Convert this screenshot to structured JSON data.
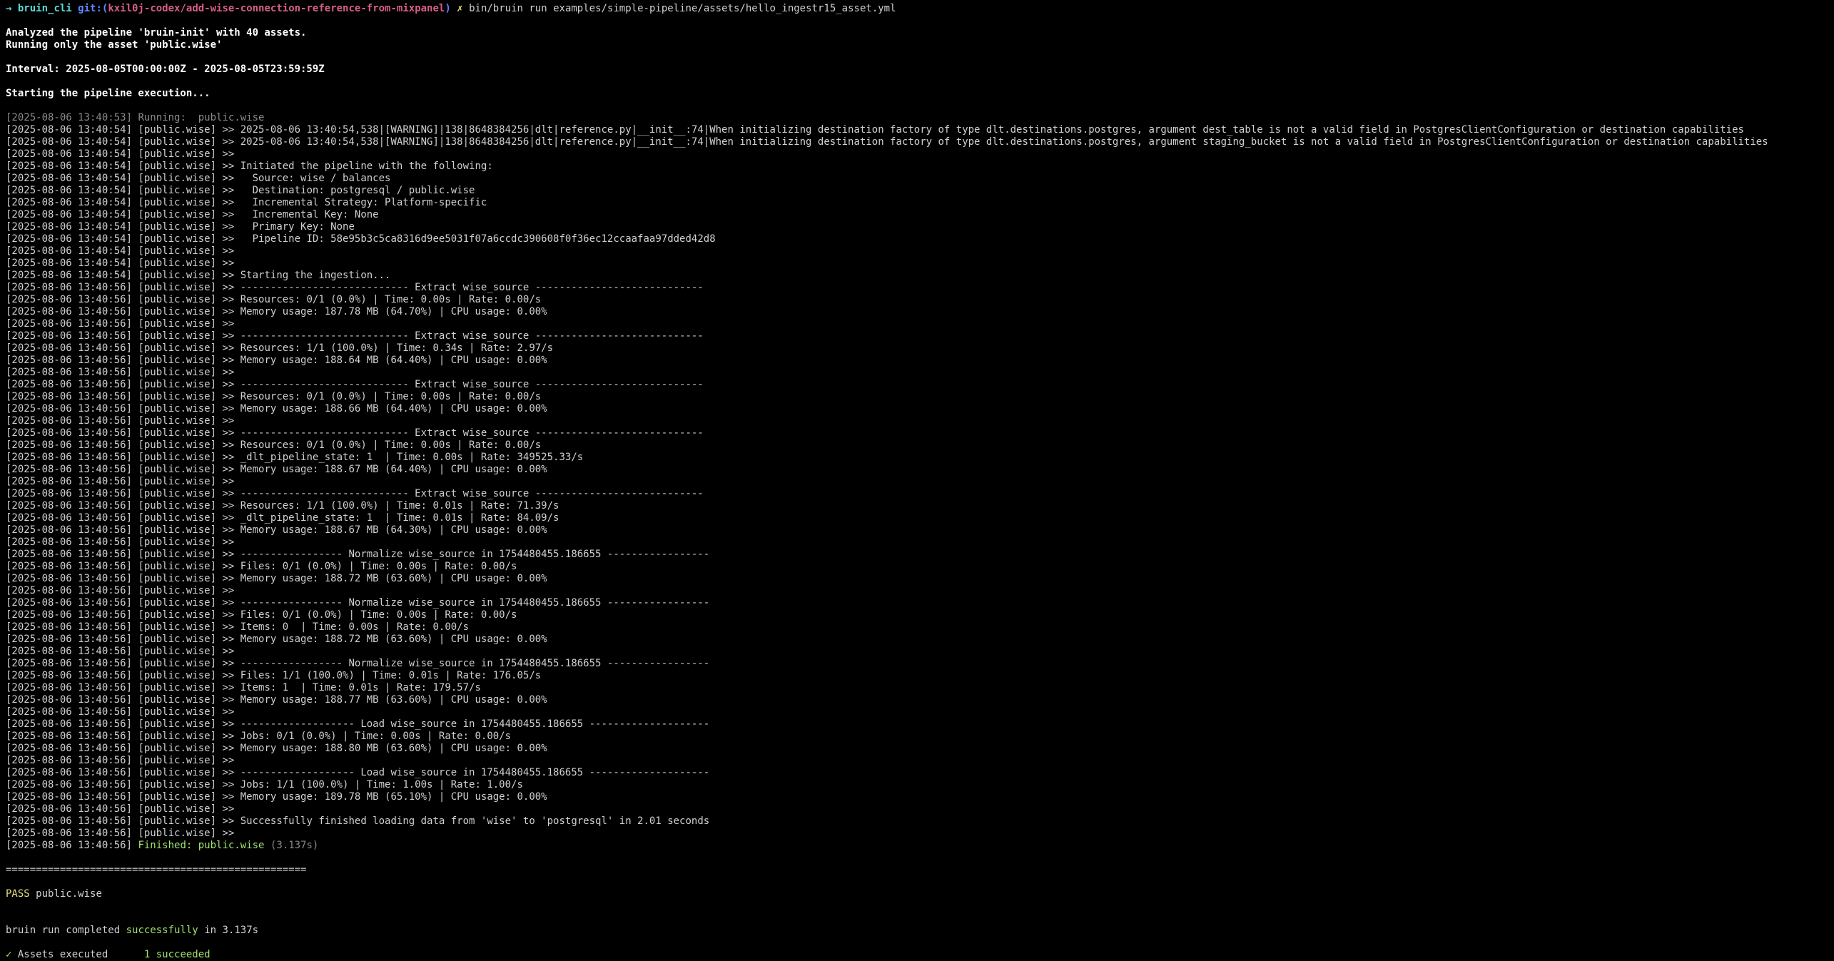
{
  "prompt": {
    "arrow": "→",
    "dir": "bruin_cli",
    "git_label": "git:(",
    "branch": "kxil0j-codex/add-wise-connection-reference-from-mixpanel",
    "git_close": ")",
    "dirty": "✗",
    "command": "bin/bruin run examples/simple-pipeline/assets/hello_ingestr15_asset.yml"
  },
  "header": {
    "analyzed": "Analyzed the pipeline 'bruin-init' with 40 assets.",
    "running_only": "Running only the asset 'public.wise'",
    "interval": "Interval: 2025-08-05T00:00:00Z - 2025-08-05T23:59:59Z",
    "starting": "Starting the pipeline execution..."
  },
  "running": {
    "ts": "[2025-08-06 13:40:53]",
    "label": "Running:  public.wise"
  },
  "log_prefix_asset": "[public.wise] >>",
  "log_lines": [
    {
      "ts": "[2025-08-06 13:40:54]",
      "msg": "2025-08-06 13:40:54,538|[WARNING]|138|8648384256|dlt|reference.py|__init__:74|When initializing destination factory of type dlt.destinations.postgres, argument dest_table is not a valid field in PostgresClientConfiguration or destination capabilities"
    },
    {
      "ts": "[2025-08-06 13:40:54]",
      "msg": "2025-08-06 13:40:54,538|[WARNING]|138|8648384256|dlt|reference.py|__init__:74|When initializing destination factory of type dlt.destinations.postgres, argument staging_bucket is not a valid field in PostgresClientConfiguration or destination capabilities"
    },
    {
      "ts": "[2025-08-06 13:40:54]",
      "msg": ""
    },
    {
      "ts": "[2025-08-06 13:40:54]",
      "msg": "Initiated the pipeline with the following:"
    },
    {
      "ts": "[2025-08-06 13:40:54]",
      "msg": "  Source: wise / balances"
    },
    {
      "ts": "[2025-08-06 13:40:54]",
      "msg": "  Destination: postgresql / public.wise"
    },
    {
      "ts": "[2025-08-06 13:40:54]",
      "msg": "  Incremental Strategy: Platform-specific"
    },
    {
      "ts": "[2025-08-06 13:40:54]",
      "msg": "  Incremental Key: None"
    },
    {
      "ts": "[2025-08-06 13:40:54]",
      "msg": "  Primary Key: None"
    },
    {
      "ts": "[2025-08-06 13:40:54]",
      "msg": "  Pipeline ID: 58e95b3c5ca8316d9ee5031f07a6ccdc390608f0f36ec12ccaafaa97dded42d8"
    },
    {
      "ts": "[2025-08-06 13:40:54]",
      "msg": ""
    },
    {
      "ts": "[2025-08-06 13:40:54]",
      "msg": ""
    },
    {
      "ts": "[2025-08-06 13:40:54]",
      "msg": "Starting the ingestion..."
    },
    {
      "ts": "[2025-08-06 13:40:56]",
      "msg": "---------------------------- Extract wise_source ----------------------------"
    },
    {
      "ts": "[2025-08-06 13:40:56]",
      "msg": "Resources: 0/1 (0.0%) | Time: 0.00s | Rate: 0.00/s"
    },
    {
      "ts": "[2025-08-06 13:40:56]",
      "msg": "Memory usage: 187.78 MB (64.70%) | CPU usage: 0.00%"
    },
    {
      "ts": "[2025-08-06 13:40:56]",
      "msg": ""
    },
    {
      "ts": "[2025-08-06 13:40:56]",
      "msg": "---------------------------- Extract wise_source ----------------------------"
    },
    {
      "ts": "[2025-08-06 13:40:56]",
      "msg": "Resources: 1/1 (100.0%) | Time: 0.34s | Rate: 2.97/s"
    },
    {
      "ts": "[2025-08-06 13:40:56]",
      "msg": "Memory usage: 188.64 MB (64.40%) | CPU usage: 0.00%"
    },
    {
      "ts": "[2025-08-06 13:40:56]",
      "msg": ""
    },
    {
      "ts": "[2025-08-06 13:40:56]",
      "msg": "---------------------------- Extract wise_source ----------------------------"
    },
    {
      "ts": "[2025-08-06 13:40:56]",
      "msg": "Resources: 0/1 (0.0%) | Time: 0.00s | Rate: 0.00/s"
    },
    {
      "ts": "[2025-08-06 13:40:56]",
      "msg": "Memory usage: 188.66 MB (64.40%) | CPU usage: 0.00%"
    },
    {
      "ts": "[2025-08-06 13:40:56]",
      "msg": ""
    },
    {
      "ts": "[2025-08-06 13:40:56]",
      "msg": "---------------------------- Extract wise_source ----------------------------"
    },
    {
      "ts": "[2025-08-06 13:40:56]",
      "msg": "Resources: 0/1 (0.0%) | Time: 0.00s | Rate: 0.00/s"
    },
    {
      "ts": "[2025-08-06 13:40:56]",
      "msg": "_dlt_pipeline_state: 1  | Time: 0.00s | Rate: 349525.33/s"
    },
    {
      "ts": "[2025-08-06 13:40:56]",
      "msg": "Memory usage: 188.67 MB (64.40%) | CPU usage: 0.00%"
    },
    {
      "ts": "[2025-08-06 13:40:56]",
      "msg": ""
    },
    {
      "ts": "[2025-08-06 13:40:56]",
      "msg": "---------------------------- Extract wise_source ----------------------------"
    },
    {
      "ts": "[2025-08-06 13:40:56]",
      "msg": "Resources: 1/1 (100.0%) | Time: 0.01s | Rate: 71.39/s"
    },
    {
      "ts": "[2025-08-06 13:40:56]",
      "msg": "_dlt_pipeline_state: 1  | Time: 0.01s | Rate: 84.09/s"
    },
    {
      "ts": "[2025-08-06 13:40:56]",
      "msg": "Memory usage: 188.67 MB (64.30%) | CPU usage: 0.00%"
    },
    {
      "ts": "[2025-08-06 13:40:56]",
      "msg": ""
    },
    {
      "ts": "[2025-08-06 13:40:56]",
      "msg": "----------------- Normalize wise_source in 1754480455.186655 -----------------"
    },
    {
      "ts": "[2025-08-06 13:40:56]",
      "msg": "Files: 0/1 (0.0%) | Time: 0.00s | Rate: 0.00/s"
    },
    {
      "ts": "[2025-08-06 13:40:56]",
      "msg": "Memory usage: 188.72 MB (63.60%) | CPU usage: 0.00%"
    },
    {
      "ts": "[2025-08-06 13:40:56]",
      "msg": ""
    },
    {
      "ts": "[2025-08-06 13:40:56]",
      "msg": "----------------- Normalize wise_source in 1754480455.186655 -----------------"
    },
    {
      "ts": "[2025-08-06 13:40:56]",
      "msg": "Files: 0/1 (0.0%) | Time: 0.00s | Rate: 0.00/s"
    },
    {
      "ts": "[2025-08-06 13:40:56]",
      "msg": "Items: 0  | Time: 0.00s | Rate: 0.00/s"
    },
    {
      "ts": "[2025-08-06 13:40:56]",
      "msg": "Memory usage: 188.72 MB (63.60%) | CPU usage: 0.00%"
    },
    {
      "ts": "[2025-08-06 13:40:56]",
      "msg": ""
    },
    {
      "ts": "[2025-08-06 13:40:56]",
      "msg": "----------------- Normalize wise_source in 1754480455.186655 -----------------"
    },
    {
      "ts": "[2025-08-06 13:40:56]",
      "msg": "Files: 1/1 (100.0%) | Time: 0.01s | Rate: 176.05/s"
    },
    {
      "ts": "[2025-08-06 13:40:56]",
      "msg": "Items: 1  | Time: 0.01s | Rate: 179.57/s"
    },
    {
      "ts": "[2025-08-06 13:40:56]",
      "msg": "Memory usage: 188.77 MB (63.60%) | CPU usage: 0.00%"
    },
    {
      "ts": "[2025-08-06 13:40:56]",
      "msg": ""
    },
    {
      "ts": "[2025-08-06 13:40:56]",
      "msg": "------------------- Load wise_source in 1754480455.186655 --------------------"
    },
    {
      "ts": "[2025-08-06 13:40:56]",
      "msg": "Jobs: 0/1 (0.0%) | Time: 0.00s | Rate: 0.00/s"
    },
    {
      "ts": "[2025-08-06 13:40:56]",
      "msg": "Memory usage: 188.80 MB (63.60%) | CPU usage: 0.00%"
    },
    {
      "ts": "[2025-08-06 13:40:56]",
      "msg": ""
    },
    {
      "ts": "[2025-08-06 13:40:56]",
      "msg": "------------------- Load wise_source in 1754480455.186655 --------------------"
    },
    {
      "ts": "[2025-08-06 13:40:56]",
      "msg": "Jobs: 1/1 (100.0%) | Time: 1.00s | Rate: 1.00/s"
    },
    {
      "ts": "[2025-08-06 13:40:56]",
      "msg": "Memory usage: 189.78 MB (65.10%) | CPU usage: 0.00%"
    },
    {
      "ts": "[2025-08-06 13:40:56]",
      "msg": ""
    },
    {
      "ts": "[2025-08-06 13:40:56]",
      "msg": "Successfully finished loading data from 'wise' to 'postgresql' in 2.01 seconds"
    },
    {
      "ts": "[2025-08-06 13:40:56]",
      "msg": ""
    }
  ],
  "finished": {
    "ts": "[2025-08-06 13:40:56]",
    "label": "Finished: public.wise",
    "duration": "(3.137s)"
  },
  "separator": "==================================================",
  "pass": {
    "status": "PASS",
    "asset": "public.wise"
  },
  "summary": {
    "prefix": "bruin run completed",
    "word": "successfully",
    "suffix": "in 3.137s"
  },
  "assets_executed": {
    "label": "Assets executed",
    "value": "1 succeeded"
  },
  "colors": {
    "background": "#000000",
    "text": "#d0d0d0",
    "branch": "#d75f87",
    "success": "#a0e36e",
    "pass": "#e8e07a"
  }
}
